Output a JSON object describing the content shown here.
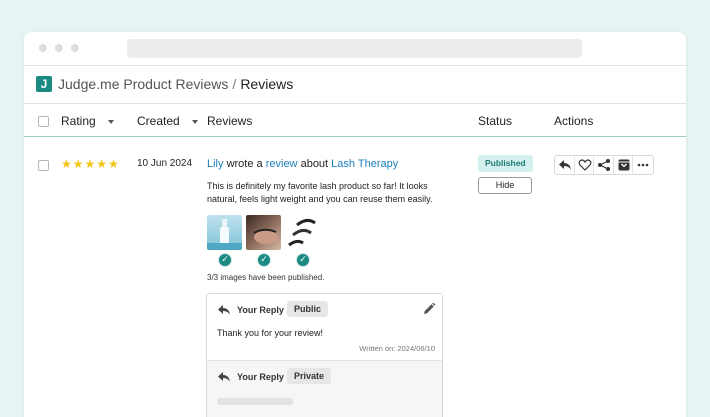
{
  "app": {
    "brand_letter": "J",
    "breadcrumb_parent": "Judge.me Product Reviews",
    "breadcrumb_sep": "/",
    "breadcrumb_current": "Reviews"
  },
  "table": {
    "columns": {
      "rating": "Rating",
      "created": "Created",
      "reviews": "Reviews",
      "status": "Status",
      "actions": "Actions"
    }
  },
  "review": {
    "rating": 5,
    "stars": "★★★★★",
    "created": "10 Jun 2024",
    "reviewer": "Lily",
    "wrote_a": "wrote a",
    "review_word": "review",
    "about": "about",
    "product": "Lash Therapy",
    "body": "This is definitely my favorite lash product so far! It looks natural, feels light weight and you can reuse them easily.",
    "images_published": "3/3 images have been published.",
    "status": "Published",
    "hide_label": "Hide"
  },
  "replies": [
    {
      "label": "Your Reply",
      "visibility": "Public",
      "text": "Thank you for your review!",
      "written": "Written on: 2024/06/10"
    },
    {
      "label": "Your Reply",
      "visibility": "Private"
    }
  ],
  "action_icons": [
    "reply-icon",
    "heart-icon",
    "share-icon",
    "archive-icon",
    "more-icon"
  ],
  "colors": {
    "background": "#e7f4f3",
    "accent": "#1b8a83",
    "link": "#1b7fbf",
    "star": "#f5c518",
    "published_badge": "#d3f0ee"
  }
}
